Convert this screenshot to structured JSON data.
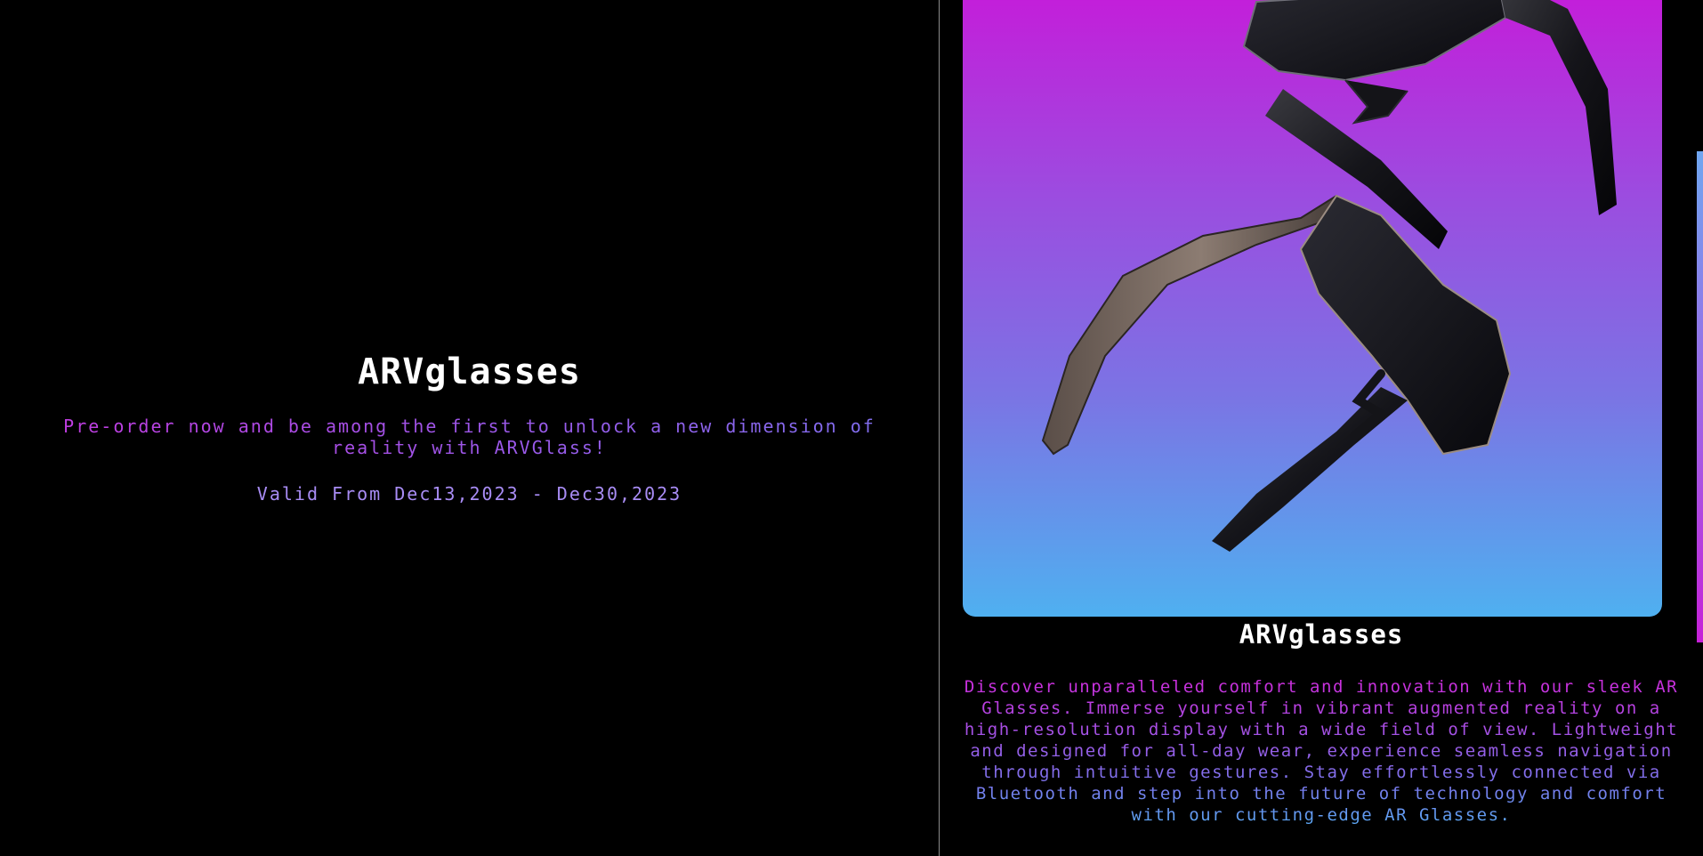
{
  "hero": {
    "title": "ARVglasses",
    "description": "Pre-order now and be among the first to unlock a new dimension of reality with ARVGlass!",
    "validity": "Valid From Dec13,2023 - Dec30,2023"
  },
  "product": {
    "title": "ARVglasses",
    "description": "Discover unparalleled comfort and innovation with our sleek AR Glasses. Immerse yourself in vibrant augmented reality on a high-resolution display with a wide field of view. Lightweight and designed for all-day wear, experience seamless navigation through intuitive gestures. Stay effortlessly connected via Bluetooth and step into the future of technology and comfort with our cutting-edge AR Glasses.",
    "image_icon": "ar-glasses-product-image"
  },
  "colors": {
    "background": "#000000",
    "accent_magenta": "#c61bd9",
    "accent_violet": "#9a4ee0",
    "accent_blue": "#4fb0f0",
    "heading": "#ffffff"
  }
}
